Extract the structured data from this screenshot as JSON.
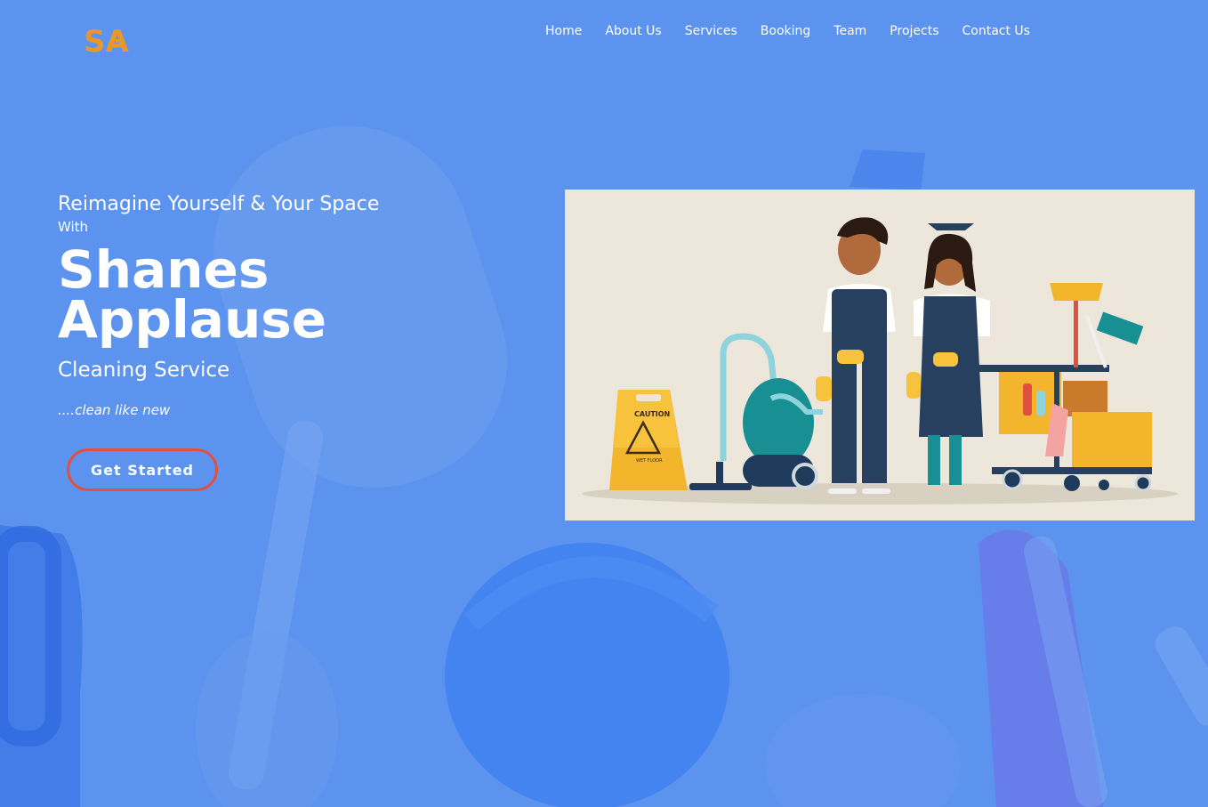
{
  "header": {
    "logo_text": "SA",
    "nav": [
      {
        "label": "Home"
      },
      {
        "label": "About Us"
      },
      {
        "label": "Services"
      },
      {
        "label": "Booking"
      },
      {
        "label": "Team"
      },
      {
        "label": "Projects"
      },
      {
        "label": "Contact Us"
      }
    ]
  },
  "hero": {
    "tagline": "Reimagine Yourself & Your Space",
    "with": "With",
    "brand_line1": "Shanes",
    "brand_line2": "Applause",
    "subtitle": "Cleaning Service",
    "slogan": "....clean like new",
    "cta_label": "Get Started"
  },
  "illustration": {
    "caution_sign_title": "CAUTION",
    "caution_sign_text": "WET FLOOR"
  },
  "colors": {
    "background": "#5c93ee",
    "cta_border": "#e0503f",
    "logo": "#e8972a",
    "illustration_bg": "#ece7da"
  }
}
